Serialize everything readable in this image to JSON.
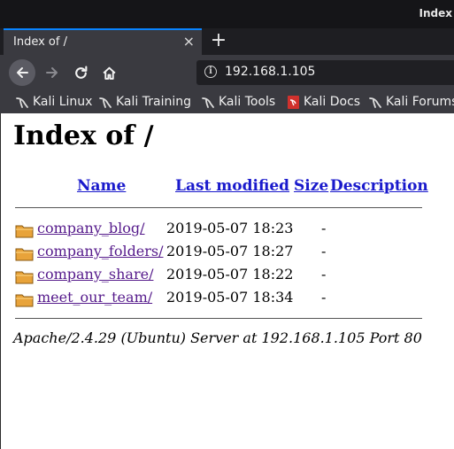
{
  "window": {
    "title": "Index"
  },
  "tab": {
    "title": "Index of /",
    "close_symbol": "×",
    "new_tab_symbol": "+"
  },
  "toolbar": {
    "url": "192.168.1.105",
    "info_symbol": "i"
  },
  "bookmarks": [
    {
      "label": "Kali Linux",
      "icon": "kali-dragon-icon"
    },
    {
      "label": "Kali Training",
      "icon": "kali-dragon-icon"
    },
    {
      "label": "Kali Tools",
      "icon": "kali-dragon-icon"
    },
    {
      "label": "Kali Docs",
      "icon": "kali-docs-icon"
    },
    {
      "label": "Kali Forums",
      "icon": "kali-dragon-icon"
    }
  ],
  "page": {
    "heading": "Index of /",
    "columns": {
      "name": "Name",
      "modified": "Last modified",
      "size": "Size",
      "description": "Description"
    },
    "entries": [
      {
        "name": "company_blog/",
        "modified": "2019-05-07 18:23",
        "size": "-"
      },
      {
        "name": "company_folders/",
        "modified": "2019-05-07 18:27",
        "size": "-"
      },
      {
        "name": "company_share/",
        "modified": "2019-05-07 18:22",
        "size": "-"
      },
      {
        "name": "meet_our_team/",
        "modified": "2019-05-07 18:34",
        "size": "-"
      }
    ],
    "footer": "Apache/2.4.29 (Ubuntu) Server at 192.168.1.105 Port 80"
  },
  "colors": {
    "accent": "#0a84ff",
    "chrome": "#3a3a40",
    "link": "#1a1acc",
    "visited_link": "#551a8b",
    "folder": "#e8a33a"
  }
}
